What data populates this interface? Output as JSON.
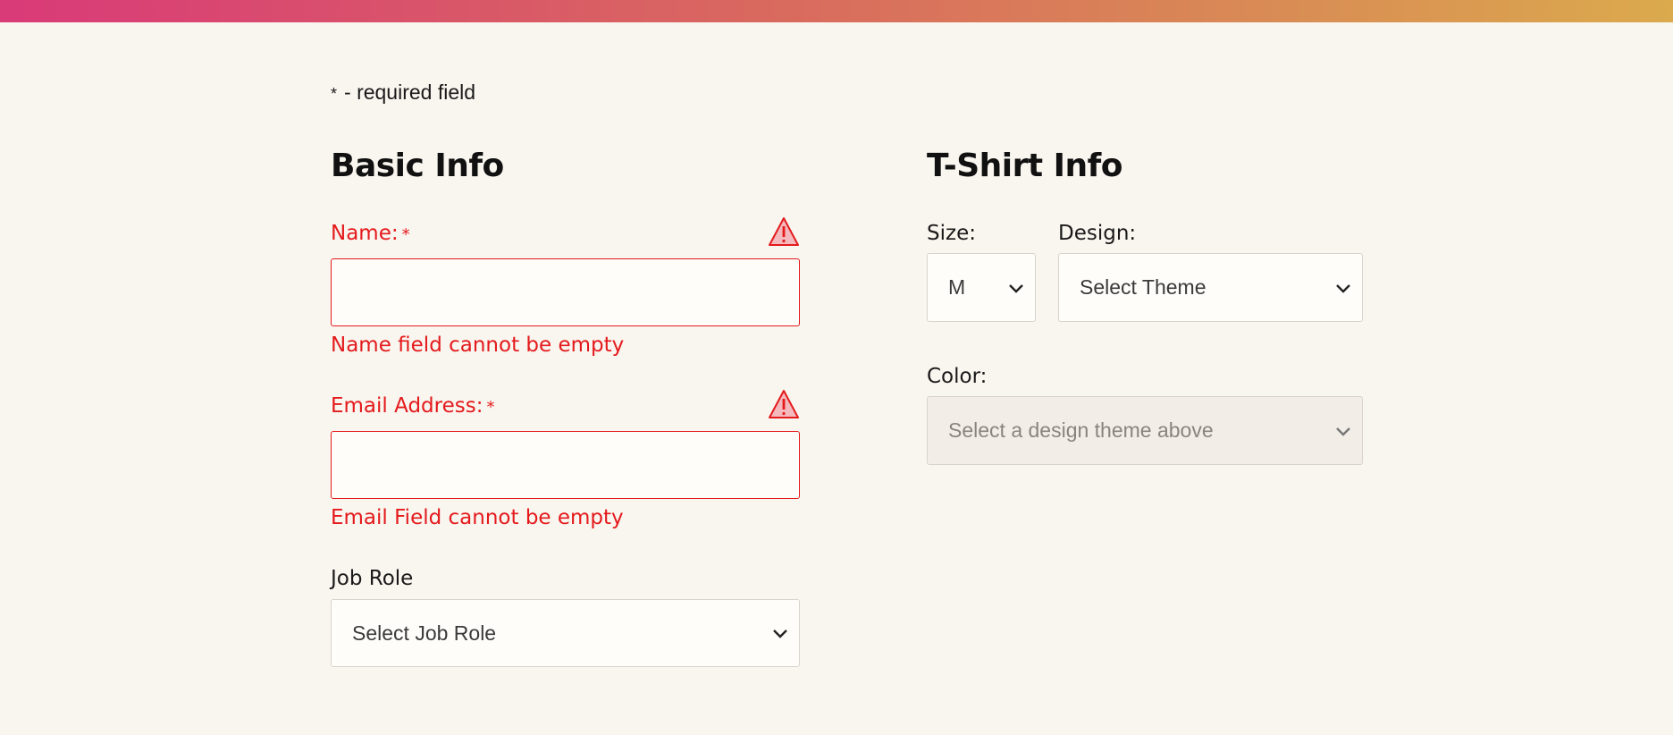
{
  "required_note": {
    "star": "*",
    "text": "- required field"
  },
  "basic_info": {
    "title": "Basic Info",
    "name": {
      "label": "Name:",
      "star": "*",
      "value": "",
      "error": "Name field cannot be empty"
    },
    "email": {
      "label": "Email Address:",
      "star": "*",
      "value": "",
      "error": "Email Field cannot be empty"
    },
    "job_role": {
      "label": "Job Role",
      "selected": "Select Job Role"
    }
  },
  "tshirt_info": {
    "title": "T-Shirt Info",
    "size": {
      "label": "Size:",
      "selected": "M"
    },
    "design": {
      "label": "Design:",
      "selected": "Select Theme"
    },
    "color": {
      "label": "Color:",
      "selected": "Select a design theme above",
      "disabled": true
    }
  },
  "colors": {
    "error": "#e41a1c",
    "background": "#f9f5ef",
    "gradient_start": "#d93a78",
    "gradient_end": "#dbaa4d"
  },
  "icons": {
    "warning": "warning-triangle-icon",
    "chevron": "chevron-down-icon"
  }
}
